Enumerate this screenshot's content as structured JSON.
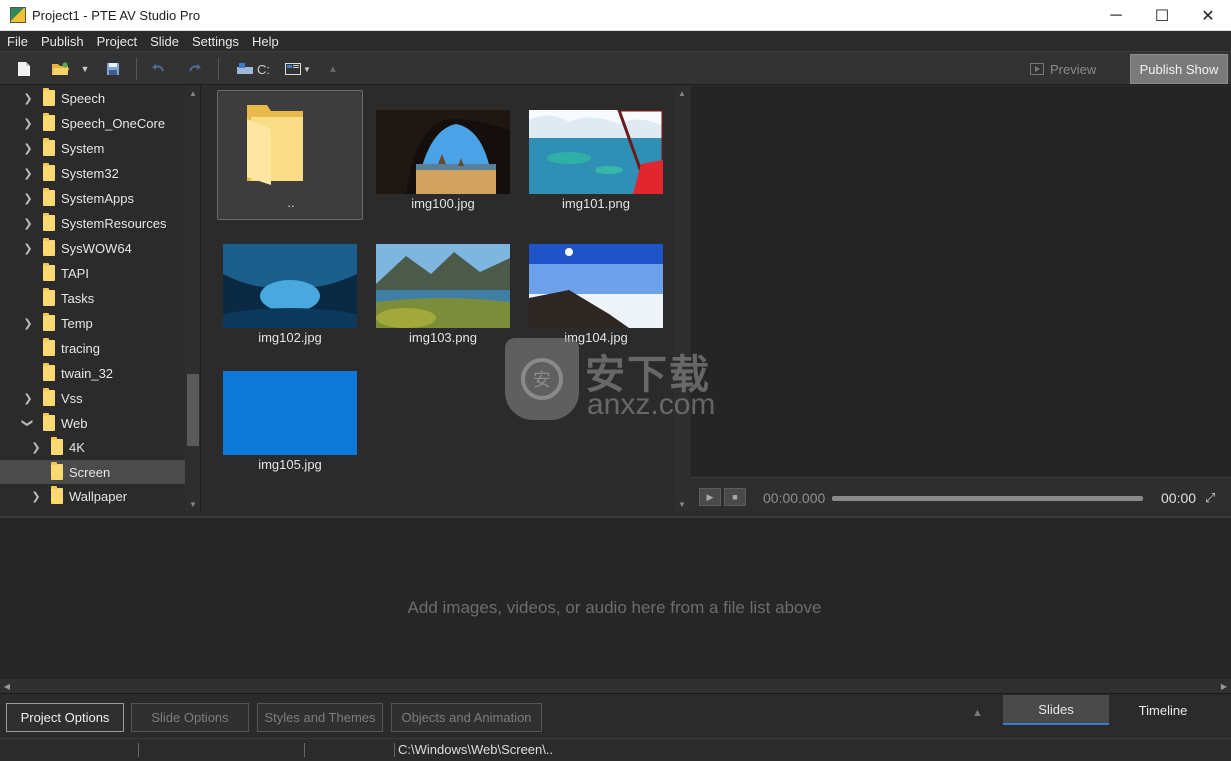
{
  "window": {
    "title": "Project1 - PTE AV Studio Pro",
    "minimize": "─",
    "maximize": "☐",
    "close": "✕"
  },
  "menu": [
    "File",
    "Publish",
    "Project",
    "Slide",
    "Settings",
    "Help"
  ],
  "toolbar": {
    "drive_label": "C:",
    "preview_label": "Preview",
    "publish_label": "Publish Show",
    "icons": [
      "new-file-icon",
      "open-folder-icon",
      "dropdown-arrow-icon",
      "save-icon",
      "undo-icon",
      "redo-icon",
      "drive-icon",
      "view-mode-icon",
      "up-folder-icon"
    ]
  },
  "tree": {
    "items": [
      {
        "label": "Speech",
        "depth": 0,
        "expandable": true,
        "expanded": false
      },
      {
        "label": "Speech_OneCore",
        "depth": 0,
        "expandable": true,
        "expanded": false
      },
      {
        "label": "System",
        "depth": 0,
        "expandable": true,
        "expanded": false
      },
      {
        "label": "System32",
        "depth": 0,
        "expandable": true,
        "expanded": false
      },
      {
        "label": "SystemApps",
        "depth": 0,
        "expandable": true,
        "expanded": false
      },
      {
        "label": "SystemResources",
        "depth": 0,
        "expandable": true,
        "expanded": false
      },
      {
        "label": "SysWOW64",
        "depth": 0,
        "expandable": true,
        "expanded": false
      },
      {
        "label": "TAPI",
        "depth": 0,
        "expandable": false,
        "expanded": false
      },
      {
        "label": "Tasks",
        "depth": 0,
        "expandable": false,
        "expanded": false
      },
      {
        "label": "Temp",
        "depth": 0,
        "expandable": true,
        "expanded": false
      },
      {
        "label": "tracing",
        "depth": 0,
        "expandable": false,
        "expanded": false
      },
      {
        "label": "twain_32",
        "depth": 0,
        "expandable": false,
        "expanded": false
      },
      {
        "label": "Vss",
        "depth": 0,
        "expandable": true,
        "expanded": false
      },
      {
        "label": "Web",
        "depth": 0,
        "expandable": true,
        "expanded": true
      },
      {
        "label": "4K",
        "depth": 1,
        "expandable": true,
        "expanded": false
      },
      {
        "label": "Screen",
        "depth": 1,
        "expandable": false,
        "expanded": false,
        "selected": true
      },
      {
        "label": "Wallpaper",
        "depth": 1,
        "expandable": true,
        "expanded": false
      }
    ]
  },
  "files": [
    {
      "name": "..",
      "kind": "parent-folder",
      "selected": true
    },
    {
      "name": "img100.jpg",
      "kind": "image",
      "scene": "cave-arch-beach"
    },
    {
      "name": "img101.png",
      "kind": "image",
      "scene": "aerial-islands"
    },
    {
      "name": "img102.jpg",
      "kind": "image",
      "scene": "ice-cave"
    },
    {
      "name": "img103.png",
      "kind": "image",
      "scene": "mountain-lake"
    },
    {
      "name": "img104.jpg",
      "kind": "image",
      "scene": "snowy-slope"
    },
    {
      "name": "img105.jpg",
      "kind": "image",
      "scene": "solid-blue"
    }
  ],
  "player": {
    "current_time": "00:00.000",
    "total_time": "00:00",
    "progress": 0
  },
  "watermark": {
    "cn": "安下载",
    "en": "anxz.com",
    "shield_glyph": "安"
  },
  "slides": {
    "empty_hint": "Add images, videos, or audio here from a file list above"
  },
  "bottom": {
    "options": [
      {
        "label": "Project Options",
        "active": true
      },
      {
        "label": "Slide Options",
        "active": false
      },
      {
        "label": "Styles and Themes",
        "active": false
      },
      {
        "label": "Objects and Animation",
        "active": false
      }
    ],
    "tabs": [
      {
        "label": "Slides",
        "active": true
      },
      {
        "label": "Timeline",
        "active": false
      }
    ]
  },
  "status": {
    "path": "C:\\Windows\\Web\\Screen\\.."
  },
  "colors": {
    "accent": "#3a7bd5",
    "background": "#2b2b2b",
    "folder": "#fbd972",
    "blue_tile": "#0c78d7"
  }
}
